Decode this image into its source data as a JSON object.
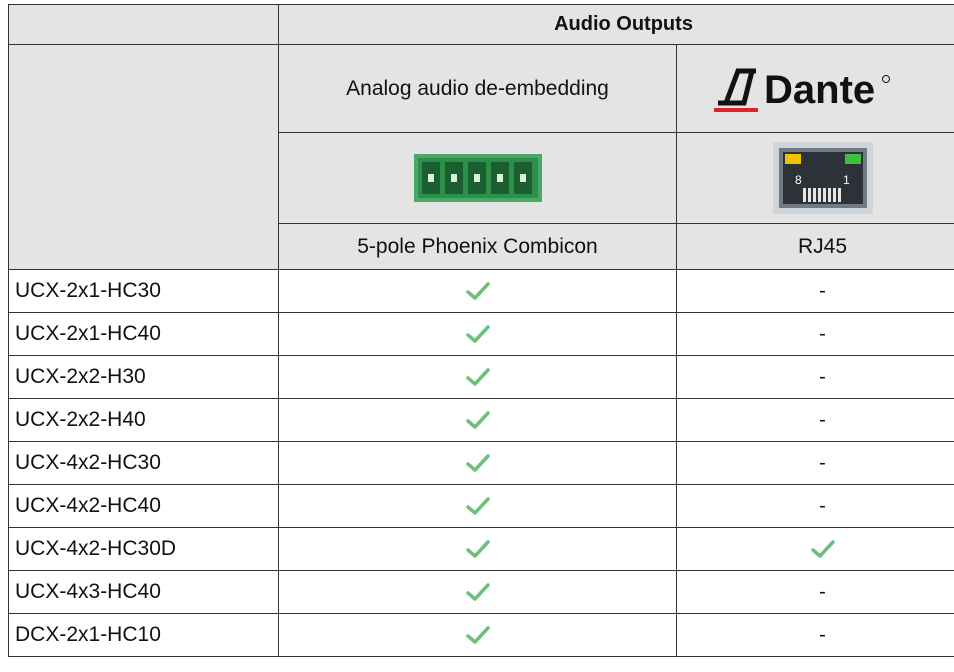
{
  "header": {
    "title": "Audio Outputs"
  },
  "columns": [
    {
      "title": "Analog audio de-embedding",
      "connector_icon": "phoenix-connector-icon",
      "connector": "5-pole Phoenix Combicon"
    },
    {
      "title": "Dante",
      "logo": "dante-logo",
      "connector_icon": "rj45-port-icon",
      "connector": "RJ45"
    }
  ],
  "rj45_pins": {
    "left": "8",
    "right": "1"
  },
  "rows": [
    {
      "model": "UCX-2x1-HC30",
      "analog": "check",
      "dante": "-"
    },
    {
      "model": "UCX-2x1-HC40",
      "analog": "check",
      "dante": "-"
    },
    {
      "model": "UCX-2x2-H30",
      "analog": "check",
      "dante": "-"
    },
    {
      "model": "UCX-2x2-H40",
      "analog": "check",
      "dante": "-"
    },
    {
      "model": "UCX-4x2-HC30",
      "analog": "check",
      "dante": "-"
    },
    {
      "model": "UCX-4x2-HC40",
      "analog": "check",
      "dante": "-"
    },
    {
      "model": "UCX-4x2-HC30D",
      "analog": "check",
      "dante": "check"
    },
    {
      "model": "UCX-4x3-HC40",
      "analog": "check",
      "dante": "-"
    },
    {
      "model": "DCX-2x1-HC10",
      "analog": "check",
      "dante": "-"
    }
  ],
  "colors": {
    "header_bg": "#e4e4e4",
    "check": "#6cc07a",
    "dante_red": "#e0222a",
    "phoenix_green": "#2e8f4a"
  }
}
